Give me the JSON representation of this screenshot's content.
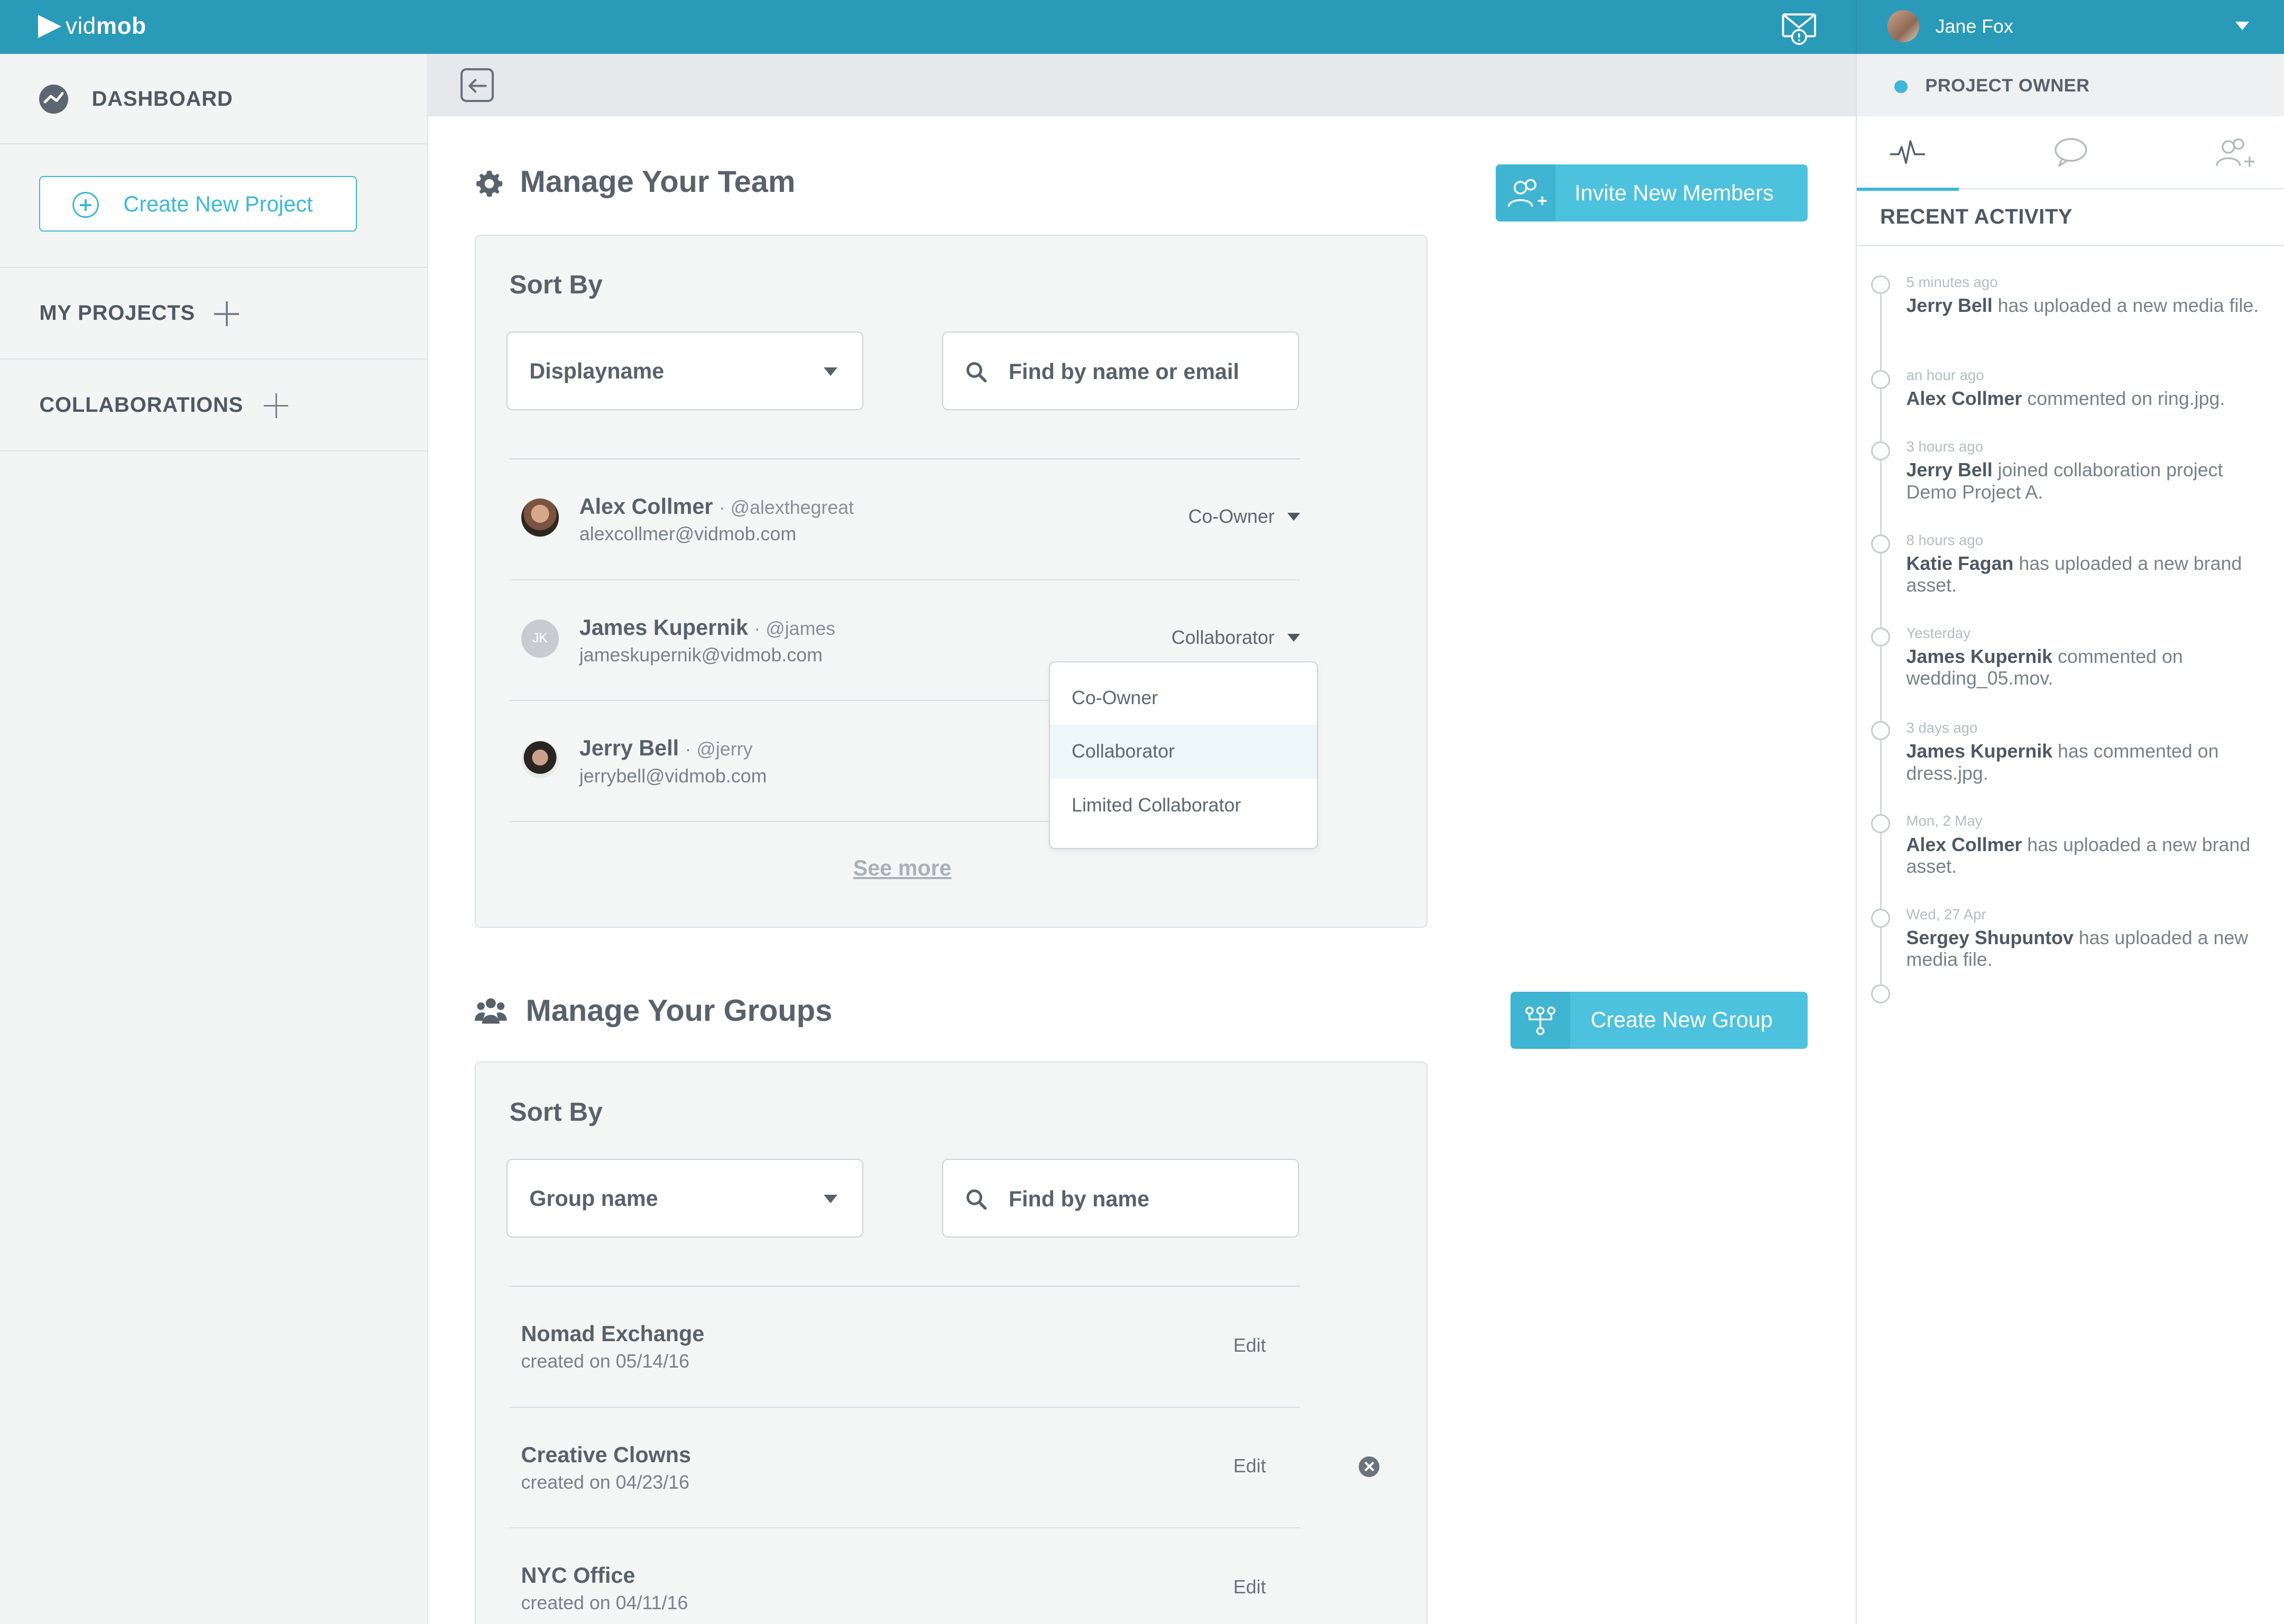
{
  "brand": {
    "name_light": "vid",
    "name_bold": "mob"
  },
  "user": {
    "name": "Jane Fox",
    "role": "PROJECT OWNER"
  },
  "sidebar": {
    "dashboard": "DASHBOARD",
    "create_project": "Create New Project",
    "my_projects": "MY PROJECTS",
    "collaborations": "COLLABORATIONS"
  },
  "team": {
    "title": "Manage Your Team",
    "invite_label": "Invite New Members",
    "sort_by": "Sort By",
    "sort_value": "Displayname",
    "search_placeholder": "Find by name or email",
    "see_more": "See more",
    "members": [
      {
        "name": "Alex Collmer",
        "handle": "· @alexthegreat",
        "email": "alexcollmer@vidmob.com",
        "role": "Co-Owner"
      },
      {
        "name": "James Kupernik",
        "handle": "· @james",
        "email": "jameskupernik@vidmob.com",
        "role": "Collaborator",
        "initials": "JK"
      },
      {
        "name": "Jerry Bell",
        "handle": "· @jerry",
        "email": "jerrybell@vidmob.com",
        "role": ""
      }
    ],
    "role_options": [
      "Co-Owner",
      "Collaborator",
      "Limited Collaborator"
    ],
    "role_selected": "Collaborator"
  },
  "groups": {
    "title": "Manage Your Groups",
    "create_label": "Create New Group",
    "sort_by": "Sort By",
    "sort_value": "Group name",
    "search_placeholder": "Find by name",
    "edit_label": "Edit",
    "items": [
      {
        "name": "Nomad Exchange",
        "created": "created on 05/14/16"
      },
      {
        "name": "Creative Clowns",
        "created": "created on 04/23/16"
      },
      {
        "name": "NYC Office",
        "created": "created on 04/11/16"
      }
    ]
  },
  "activity": {
    "title": "RECENT ACTIVITY",
    "tabs": [
      "activity-pulse-icon",
      "chat-bubble-icon",
      "add-users-icon"
    ],
    "items": [
      {
        "time": "5 minutes ago",
        "actor": "Jerry Bell",
        "text": " has uploaded a new media file."
      },
      {
        "time": "an hour ago",
        "actor": "Alex Collmer",
        "text": " commented on ring.jpg."
      },
      {
        "time": "3 hours ago",
        "actor": "Jerry Bell",
        "text": " joined collaboration project Demo Project A."
      },
      {
        "time": "8 hours ago",
        "actor": "Katie Fagan",
        "text": " has uploaded a new brand asset."
      },
      {
        "time": "Yesterday",
        "actor": "James Kupernik",
        "text": " commented on wedding_05.mov."
      },
      {
        "time": "3 days ago",
        "actor": "James Kupernik",
        "text": " has commented on dress.jpg."
      },
      {
        "time": "Mon, 2 May",
        "actor": "Alex Collmer",
        "text": " has uploaded a new brand asset."
      },
      {
        "time": "Wed, 27 Apr",
        "actor": "Sergey Shupuntov",
        "text": " has uploaded a new media file."
      }
    ]
  },
  "colors": {
    "topbar": "#2a9ab9",
    "accent": "#4dc2de",
    "text": "#59616b",
    "sidebar_bg": "#f3f4f4"
  }
}
